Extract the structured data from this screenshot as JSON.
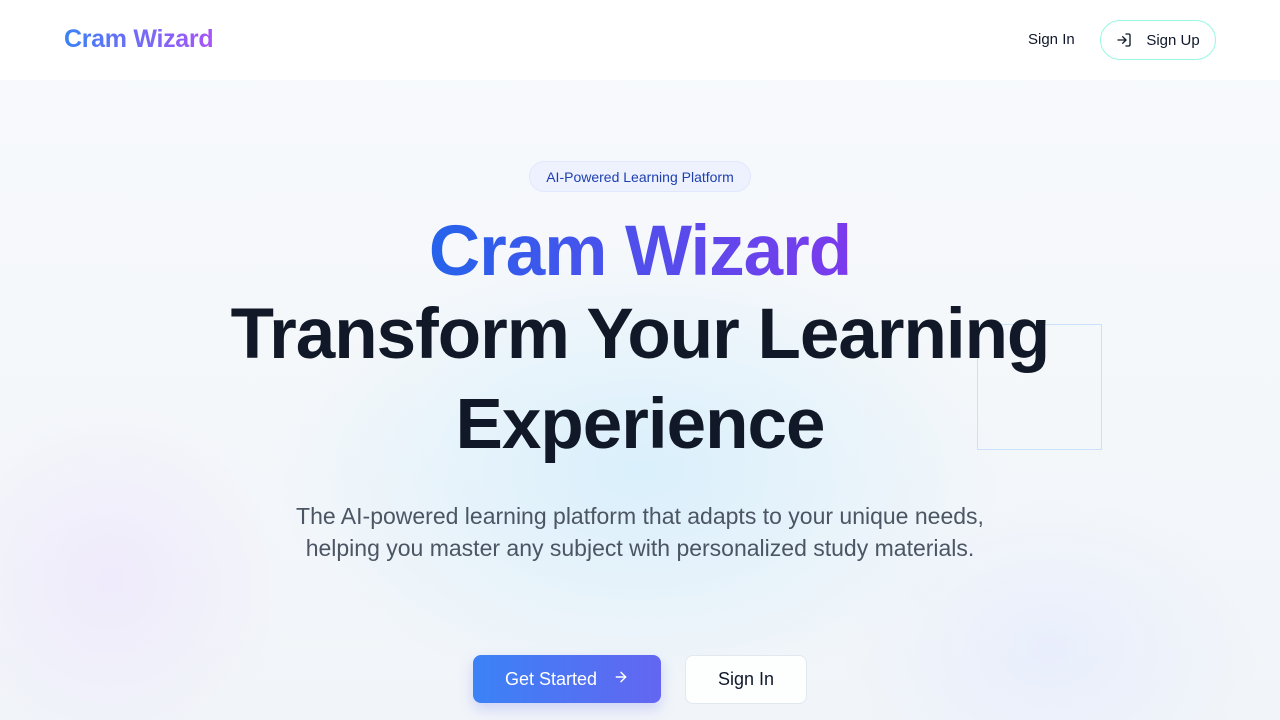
{
  "app": {
    "logo_text": "Cram Wizard",
    "accent_gradient": [
      "#3b82f6",
      "#a855f7"
    ]
  },
  "nav": {
    "sign_in_label": "Sign In",
    "sign_up_label": "Sign Up",
    "sign_up_icon": "login-arrow-icon"
  },
  "hero": {
    "badge": "AI-Powered Learning Platform",
    "brand_name": "Cram Wizard",
    "title_line_1": "Transform Your Learning",
    "title_line_2": "Experience",
    "subtitle": "The AI-powered learning platform that adapts to your unique needs, helping you master any subject with personalized study materials.",
    "primary_cta_label": "Get Started",
    "primary_cta_icon": "arrow-right-icon",
    "secondary_cta_label": "Sign In"
  }
}
